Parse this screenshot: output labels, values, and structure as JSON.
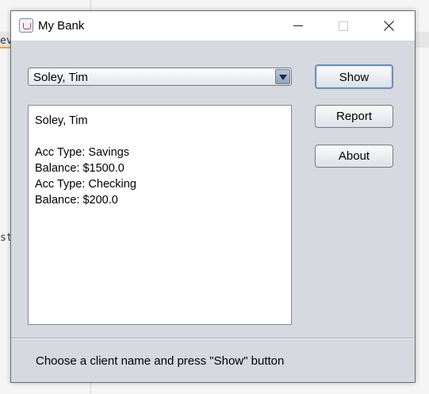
{
  "background": {
    "fragment_1": "ev",
    "fragment_2": "st"
  },
  "window": {
    "title": "My Bank",
    "controls": {
      "minimize_icon": "minimize-icon",
      "maximize_icon": "maximize-icon",
      "close_icon": "close-icon"
    }
  },
  "client_select": {
    "selected": "Soley, Tim"
  },
  "details": {
    "lines": [
      "Soley, Tim",
      "",
      "Acc Type: Savings",
      "Balance: $1500.0",
      "Acc Type: Checking",
      "Balance: $200.0"
    ]
  },
  "buttons": {
    "show": "Show",
    "report": "Report",
    "about": "About"
  },
  "status": {
    "text": "Choose a client name and press \"Show\" button"
  },
  "colors": {
    "window_bg": "#d6d9e0",
    "titlebar_bg": "#ffffff",
    "focus_border": "#6f8fb5"
  }
}
